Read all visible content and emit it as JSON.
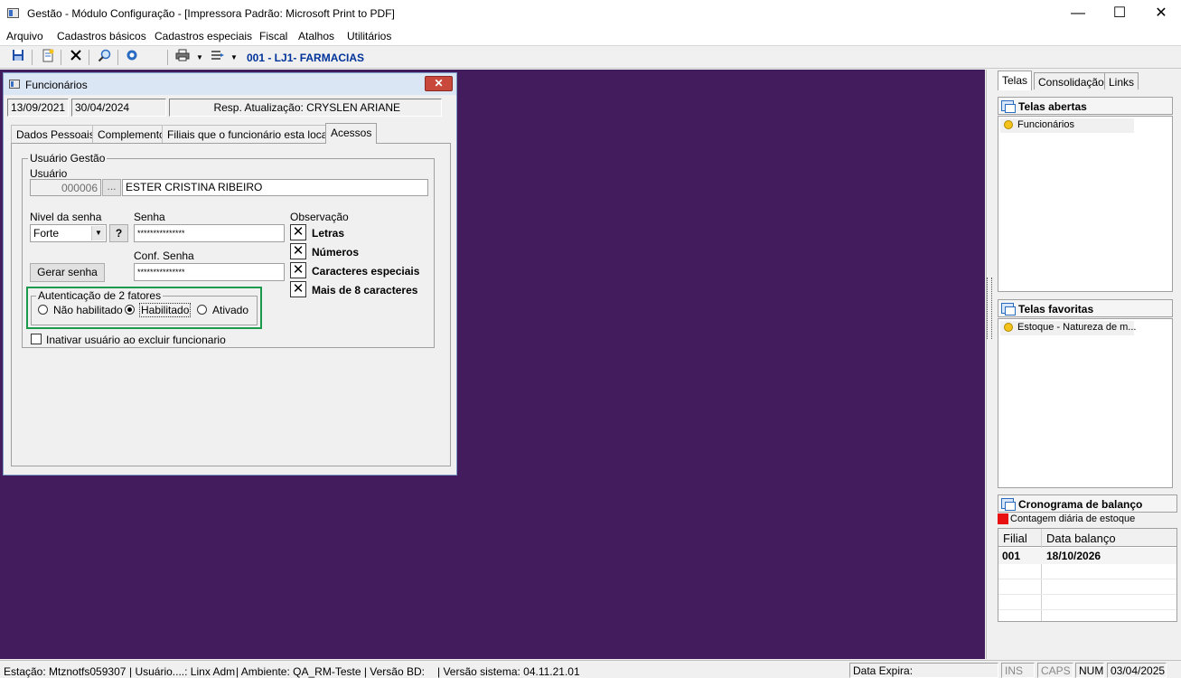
{
  "window": {
    "title": "Gestão  - Módulo Configuração - [Impressora Padrão: Microsoft Print to PDF]",
    "minimize": "—",
    "maximize": "☐",
    "close": "✕"
  },
  "menu": [
    "Arquivo",
    "Cadastros básicos",
    "Cadastros especiais",
    "Fiscal",
    "Atalhos",
    "Utilitários"
  ],
  "toolbar": {
    "store_label": "001 - LJ1- FARMACIAS",
    "icons": [
      "save-icon",
      "new-document-icon",
      "delete-icon",
      "search-icon",
      "settings-icon",
      "print-icon",
      "list-icon"
    ]
  },
  "child": {
    "title": "Funcionários",
    "close": "✕",
    "date_created": "13/09/2021",
    "date_updated": "30/04/2024",
    "resp_update": "Resp. Atualização: CRYSLEN ARIANE",
    "tabs": [
      "Dados Pessoais",
      "Complemento",
      "Filiais que o funcionário esta locado",
      "Acessos"
    ],
    "active_tab": 3,
    "group_title": "Usuário Gestão",
    "usuario_label": "Usuário",
    "usuario_code": "000006",
    "ellipsis": "...",
    "usuario_name": "ESTER CRISTINA RIBEIRO",
    "nivel_label": "Nivel da senha",
    "nivel_value": "Forte",
    "help": "?",
    "senha_label": "Senha",
    "senha_value": "***************",
    "conf_label": "Conf. Senha",
    "conf_value": "***************",
    "gerar_button": "Gerar senha",
    "obs_label": "Observação",
    "checks": [
      "Letras",
      "Números",
      "Caracteres especiais",
      "Mais de 8 caracteres"
    ],
    "check_mark": "✕",
    "auth_title": "Autenticação de 2 fatores",
    "auth_options": [
      "Não habilitado",
      "Habilitado",
      "Ativado"
    ],
    "auth_selected": "Habilitado",
    "inativar_label": "Inativar usuário ao excluir funcionario"
  },
  "right": {
    "tabs": [
      "Telas",
      "Consolidação",
      "Links"
    ],
    "telas_abertas": "Telas abertas",
    "abertas_items": [
      "Funcionários"
    ],
    "telas_favoritas": "Telas favoritas",
    "favoritas_items": [
      "Estoque - Natureza de m..."
    ],
    "cronograma": "Cronograma de balanço",
    "legend": "Contagem diária de estoque",
    "legend_color": "#e81010",
    "table_headers": [
      "Filial",
      "Data balanço"
    ],
    "table_rows": [
      [
        "001",
        "18/10/2026"
      ]
    ]
  },
  "status": {
    "estacao": "Estação: Mtznotfs059307",
    "usuario": "| Usuário....: Linx Adm",
    "ambiente": "| Ambiente: QA_RM-Teste | Versão BD:",
    "versao": "| Versão sistema: 04.11.21.01",
    "expira": "Data Expira:",
    "ins": "INS",
    "caps": "CAPS",
    "num": "NUM",
    "date": "03/04/2025"
  },
  "colors": {
    "mdi_background": "#431c5d",
    "highlight_border": "#1a9a4a",
    "store_text": "#003399"
  }
}
